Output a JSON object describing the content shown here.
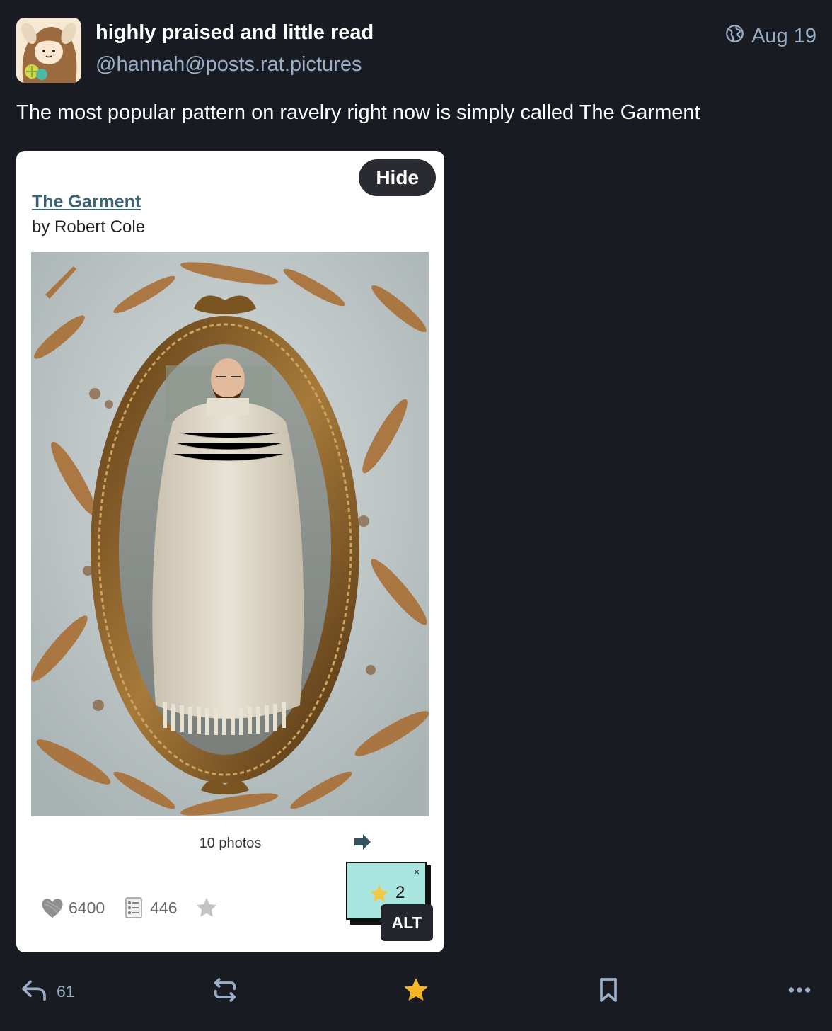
{
  "author": {
    "display_name": "highly praised and little read",
    "handle": "@hannah@posts.rat.pictures"
  },
  "post": {
    "timestamp": "Aug 19",
    "visibility_icon": "globe-icon",
    "text": "The most popular pattern on ravelry right now is simply called The Garment"
  },
  "media": {
    "hide_label": "Hide",
    "pattern_title": "The Garment",
    "pattern_author": "by Robert Cole",
    "photo_count": "10 photos",
    "stats": {
      "hearts": "6400",
      "projects": "446"
    },
    "badge_count": "2",
    "badge_close": "×",
    "alt_label": "ALT"
  },
  "actions": {
    "reply_count": "61"
  },
  "colors": {
    "background": "#191b22",
    "muted": "#9baec8",
    "favourite": "#f5b625",
    "link": "#3d6474"
  }
}
